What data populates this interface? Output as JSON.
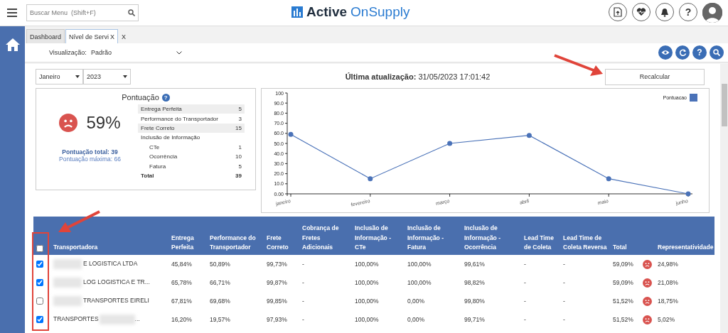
{
  "topbar": {
    "search": {
      "placeholder": "Buscar Menu  (Shift+F)"
    },
    "logo": {
      "bold": "Active",
      "light": "OnSupply"
    },
    "help_label": "?"
  },
  "tabs": [
    {
      "label": "Dashboard",
      "selected": false
    },
    {
      "label": "Nível de Servi",
      "selected": true,
      "close": "X"
    }
  ],
  "tabs_close": "X",
  "view": {
    "label": "Visualização:",
    "value": "Padrão",
    "help_label": "?"
  },
  "filters": {
    "month": "Janeiro",
    "year": "2023"
  },
  "last_update": {
    "label": "Última atualização:",
    "value": "31/05/2023 17:01:42"
  },
  "recalc_button": "Recalcular",
  "score": {
    "title": "Pontuação",
    "help": "?",
    "percent": "59%",
    "total": "Pontuação total: 39",
    "max": "Pontuação máxima: 66",
    "rows": [
      {
        "kind": "item",
        "label": "Entrega Perfeita",
        "value": "5",
        "shaded": true
      },
      {
        "kind": "item",
        "label": "Performance do Transportador",
        "value": "3",
        "shaded": false
      },
      {
        "kind": "item",
        "label": "Frete Correto",
        "value": "15",
        "shaded": true
      },
      {
        "kind": "item",
        "label": "Inclusão de Informação",
        "value": "",
        "shaded": false
      },
      {
        "kind": "sub",
        "label": "CTe",
        "value": "1",
        "shaded": false
      },
      {
        "kind": "sub",
        "label": "Ocorrência",
        "value": "10",
        "shaded": false
      },
      {
        "kind": "sub",
        "label": "Fatura",
        "value": "5",
        "shaded": false
      },
      {
        "kind": "total",
        "label": "Total",
        "value": "39",
        "shaded": false
      }
    ]
  },
  "chart_data": {
    "type": "line",
    "categories": [
      "janeiro",
      "fevereiro",
      "março",
      "abril",
      "maio",
      "junho"
    ],
    "series": [
      {
        "name": "Pontuacao",
        "color": "#4a72b8",
        "marker": true,
        "values": [
          59,
          15,
          50,
          58,
          15,
          0
        ]
      }
    ],
    "ylim": [
      0,
      100
    ],
    "yticks": [
      {
        "value": 0,
        "label": "0.00"
      },
      {
        "value": 10,
        "label": "10.0"
      },
      {
        "value": 20,
        "label": "20.0"
      },
      {
        "value": 30,
        "label": "30.0"
      },
      {
        "value": 40,
        "label": "40.0"
      },
      {
        "value": 50,
        "label": "50.0"
      },
      {
        "value": 60,
        "label": "60.0"
      },
      {
        "value": 70,
        "label": "70.0"
      },
      {
        "value": 80,
        "label": "80.0"
      },
      {
        "value": 90,
        "label": "90.0"
      },
      {
        "value": 100,
        "label": "100"
      }
    ]
  },
  "table": {
    "all_checked": false,
    "columns": [
      "Transportadora",
      "Entrega Perfeita",
      "Performance do Transportador",
      "Frete Correto",
      "Cobrança de Fretes Adicionais",
      "Inclusão de Informação - CTe",
      "Inclusão de Informação - Fatura",
      "Inclusão de Informação - Ocorrência",
      "Lead Time de Coleta",
      "Lead Time de Coleta Reversa",
      "Total",
      "",
      "Representatividade"
    ],
    "rows": [
      {
        "checked": true,
        "cells": [
          "E LOGISTICA LTDA",
          "45,84%",
          "50,89%",
          "99,73%",
          "-",
          "100,00%",
          "100,00%",
          "99,61%",
          "-",
          "-",
          "59,09%",
          "24,98%"
        ]
      },
      {
        "checked": true,
        "cells": [
          "LOG LOGISTICA E TR...",
          "65,78%",
          "66,71%",
          "99,87%",
          "-",
          "100,00%",
          "100,00%",
          "98,82%",
          "-",
          "-",
          "59,09%",
          "21,08%"
        ]
      },
      {
        "checked": false,
        "cells": [
          "TRANSPORTES EIRELI",
          "67,81%",
          "69,68%",
          "99,85%",
          "-",
          "100,00%",
          "0,00%",
          "99,80%",
          "-",
          "-",
          "51,52%",
          "18,75%"
        ]
      },
      {
        "checked": true,
        "cells": [
          "TRANSPORTES",
          "16,20%",
          "19,57%",
          "97,93%",
          "-",
          "100,00%",
          "0,00%",
          "99,71%",
          "-",
          "-",
          "51,52%",
          "5,02%"
        ],
        "tail": "..."
      }
    ]
  }
}
